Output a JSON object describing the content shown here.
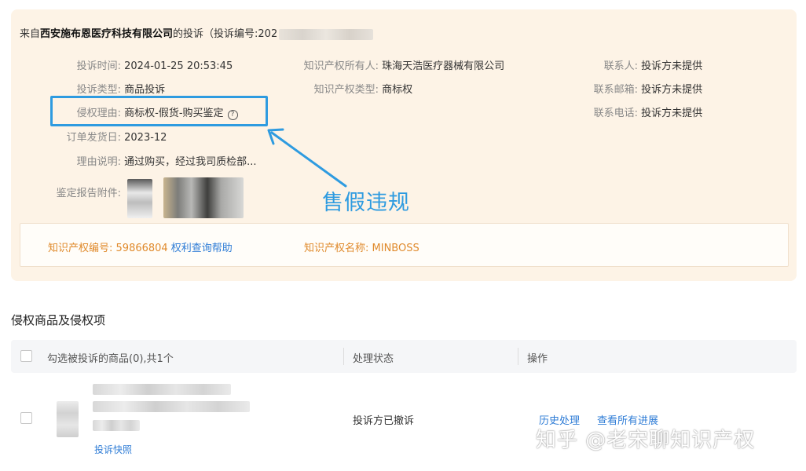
{
  "complaint": {
    "prefix": "来自",
    "company": "西安施布恩医疗科技有限公司",
    "suffix": "的投诉（投诉编号:202",
    "fields_left": [
      {
        "label": "投诉时间:",
        "value": "2024-01-25 20:53:45"
      },
      {
        "label": "投诉类型:",
        "value": "商品投诉"
      },
      {
        "label": "侵权理由:",
        "value": "商标权-假货-购买鉴定"
      },
      {
        "label": "订单发货日:",
        "value": "2023-12"
      },
      {
        "label": "理由说明:",
        "value": "通过购买，经过我司质检部..."
      },
      {
        "label": "鉴定报告附件:",
        "value": ""
      }
    ],
    "fields_mid": [
      {
        "label": "知识产权所有人:",
        "value": "珠海天浩医疗器械有限公司"
      },
      {
        "label": "知识产权类型:",
        "value": "商标权"
      }
    ],
    "fields_right": [
      {
        "label": "联系人:",
        "value": "投诉方未提供"
      },
      {
        "label": "联系邮箱:",
        "value": "投诉方未提供"
      },
      {
        "label": "联系电话:",
        "value": "投诉方未提供"
      }
    ],
    "help_icon": "question-circle-icon",
    "annotation": "售假违规"
  },
  "ip_info": {
    "number_label": "知识产权编号:",
    "number_value": "59866804",
    "query_link": "权利查询帮助",
    "name_label": "知识产权名称:",
    "name_value": "MINBOSS"
  },
  "section": {
    "title": "侵权商品及侵权项"
  },
  "table": {
    "headers": [
      "勾选被投诉的商品(0),共1个",
      "处理状态",
      "操作"
    ],
    "rows": [
      {
        "snapshot_link": "投诉快照",
        "status": "投诉方已撤诉",
        "actions": [
          "历史处理",
          "查看所有进展"
        ]
      }
    ]
  },
  "watermark": "知乎 @老宋聊知识产权",
  "colors": {
    "card_bg": "#fdf3e6",
    "accent_orange": "#e08a2c",
    "link_blue": "#2e7cd6",
    "annotation_blue": "#2e9be0"
  }
}
